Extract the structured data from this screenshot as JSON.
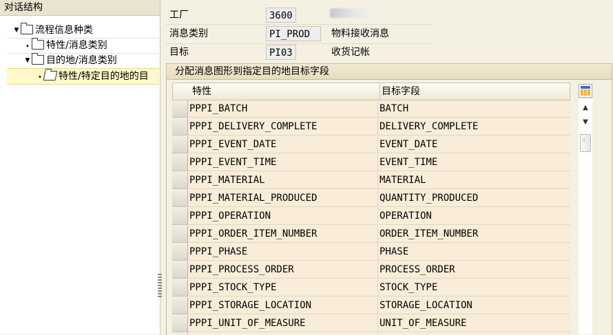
{
  "tree": {
    "title": "对话结构",
    "nodes": [
      {
        "label": "流程信息种类",
        "marker": "▼"
      },
      {
        "label": "特性/消息类别",
        "marker": "•"
      },
      {
        "label": "目的地/消息类别",
        "marker": "▼"
      },
      {
        "label": "特性/特定目的地的目",
        "marker": "•"
      }
    ]
  },
  "header": {
    "plant": {
      "label": "工厂",
      "value": "3600"
    },
    "msg_category": {
      "label": "消息类别",
      "value": "PI_PROD",
      "desc": "物料接收消息"
    },
    "target": {
      "label": "目标",
      "value": "PI03",
      "desc": "收货记帐"
    }
  },
  "group": {
    "title": "分配消息图形到指定目的地目标字段"
  },
  "table": {
    "columns": [
      "特性",
      "目标字段"
    ],
    "rows": [
      [
        "PPPI_BATCH",
        "BATCH"
      ],
      [
        "PPPI_DELIVERY_COMPLETE",
        "DELIVERY_COMPLETE"
      ],
      [
        "PPPI_EVENT_DATE",
        "EVENT_DATE"
      ],
      [
        "PPPI_EVENT_TIME",
        "EVENT_TIME"
      ],
      [
        "PPPI_MATERIAL",
        "MATERIAL"
      ],
      [
        "PPPI_MATERIAL_PRODUCED",
        "QUANTITY_PRODUCED"
      ],
      [
        "PPPI_OPERATION",
        "OPERATION"
      ],
      [
        "PPPI_ORDER_ITEM_NUMBER",
        "ORDER_ITEM_NUMBER"
      ],
      [
        "PPPI_PHASE",
        "PHASE"
      ],
      [
        "PPPI_PROCESS_ORDER",
        "PROCESS_ORDER"
      ],
      [
        "PPPI_STOCK_TYPE",
        "STOCK_TYPE"
      ],
      [
        "PPPI_STORAGE_LOCATION",
        "STORAGE_LOCATION"
      ],
      [
        "PPPI_UNIT_OF_MEASURE",
        "UNIT_OF_MEASURE"
      ],
      [
        "",
        ""
      ]
    ]
  },
  "scroll": {
    "up": "▲",
    "down": "▼"
  }
}
